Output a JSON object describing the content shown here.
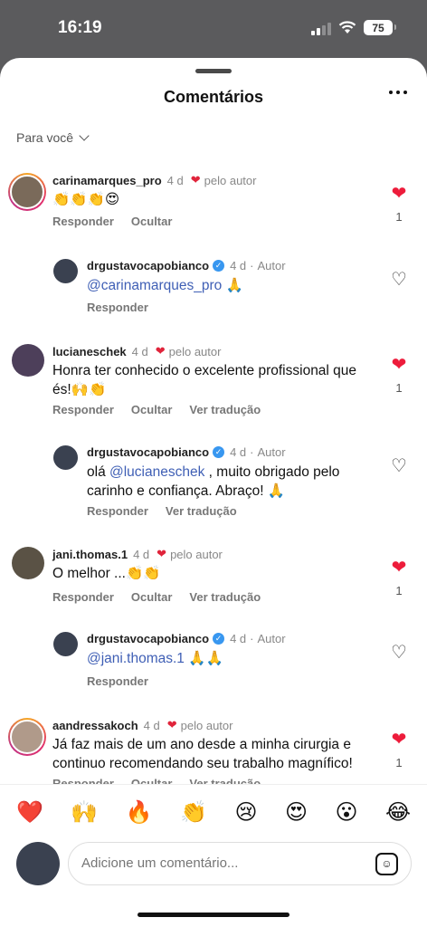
{
  "status": {
    "time": "16:19",
    "battery": "75"
  },
  "sheet": {
    "title": "Comentários",
    "filter": "Para você"
  },
  "comments": [
    {
      "user": "carinamarques_pro",
      "time": "4 d",
      "by_author": "pelo autor",
      "text": "👏👏👏😍",
      "reply": "Responder",
      "hide": "Ocultar",
      "likes": "1"
    },
    {
      "user": "drgustavocapobianco",
      "time": "4 d",
      "author": "Autor",
      "mention": "@carinamarques_pro",
      "text": " 🙏",
      "reply": "Responder"
    },
    {
      "user": "lucianeschek",
      "time": "4 d",
      "by_author": "pelo autor",
      "text": "Honra ter conhecido o excelente profissional que és!🙌👏",
      "reply": "Responder",
      "hide": "Ocultar",
      "translate": "Ver tradução",
      "likes": "1"
    },
    {
      "user": "drgustavocapobianco",
      "time": "4 d",
      "author": "Autor",
      "pre": "olá ",
      "mention": "@lucianeschek",
      "text": " , muito obrigado pelo carinho e confiança. Abraço! 🙏",
      "reply": "Responder",
      "translate": "Ver tradução"
    },
    {
      "user": "jani.thomas.1",
      "time": "4 d",
      "by_author": "pelo autor",
      "text": "O melhor ...👏👏",
      "reply": "Responder",
      "hide": "Ocultar",
      "translate": "Ver tradução",
      "likes": "1"
    },
    {
      "user": "drgustavocapobianco",
      "time": "4 d",
      "author": "Autor",
      "mention": "@jani.thomas.1",
      "text": " 🙏🙏",
      "reply": "Responder"
    },
    {
      "user": "aandressakoch",
      "time": "4 d",
      "by_author": "pelo autor",
      "text": "Já faz mais de um ano desde a minha cirurgia e continuo recomendando seu trabalho magnífico!",
      "reply": "Responder",
      "hide": "Ocultar",
      "translate": "Ver tradução",
      "likes": "1"
    }
  ],
  "emoji_bar": [
    "❤️",
    "🙌",
    "🔥",
    "👏",
    "😢",
    "😍",
    "😮",
    "😂"
  ],
  "composer": {
    "placeholder": "Adicione um comentário..."
  },
  "colors": {
    "like_red": "#ed1c3b",
    "mention_blue": "#3f5fb5",
    "verified_blue": "#3897f0"
  }
}
